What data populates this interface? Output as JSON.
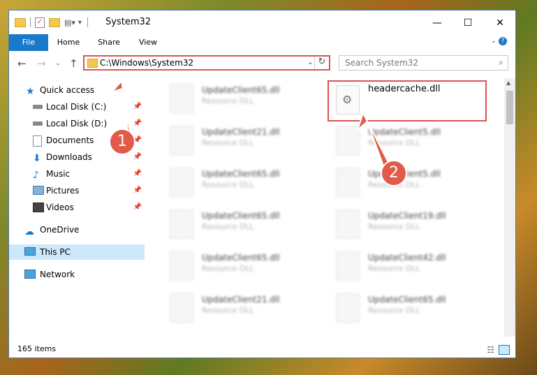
{
  "window": {
    "title": "System32",
    "minimize": "—",
    "maximize": "☐",
    "close": "✕"
  },
  "ribbon": {
    "tabs": [
      "File",
      "Home",
      "Share",
      "View"
    ]
  },
  "nav": {
    "path": "C:\\Windows\\System32",
    "search_placeholder": "Search System32"
  },
  "sidebar": {
    "quick_access": "Quick access",
    "items": [
      "Local Disk (C:)",
      "Local Disk (D:)",
      "Documents",
      "Downloads",
      "Music",
      "Pictures",
      "Videos"
    ],
    "onedrive": "OneDrive",
    "this_pc": "This PC",
    "network": "Network"
  },
  "files": {
    "highlighted": {
      "name": "headercache.dll"
    },
    "left": [
      {
        "name": "UpdateClient65.dll",
        "type": "Resource DLL"
      },
      {
        "name": "UpdateClient21.dll",
        "type": "Resource DLL"
      },
      {
        "name": "UpdateClient65.dll",
        "type": "Resource DLL"
      },
      {
        "name": "UpdateClient65.dll",
        "type": "Resource DLL"
      },
      {
        "name": "UpdateClient65.dll",
        "type": "Resource DLL"
      },
      {
        "name": "UpdateClient21.dll",
        "type": "Resource DLL"
      }
    ],
    "right": [
      {
        "name": "UpdateClient5.dll",
        "type": "Resource DLL"
      },
      {
        "name": "UpdateClient5.dll",
        "type": "Resource DLL"
      },
      {
        "name": "UpdateClient19.dll",
        "type": "Resource DLL"
      },
      {
        "name": "UpdateClient42.dll",
        "type": "Resource DLL"
      },
      {
        "name": "UpdateClient65.dll",
        "type": "Resource DLL"
      }
    ]
  },
  "status": {
    "count": "165 items"
  },
  "annotations": {
    "badge1": "1",
    "badge2": "2",
    "color": "#e15a4a"
  }
}
